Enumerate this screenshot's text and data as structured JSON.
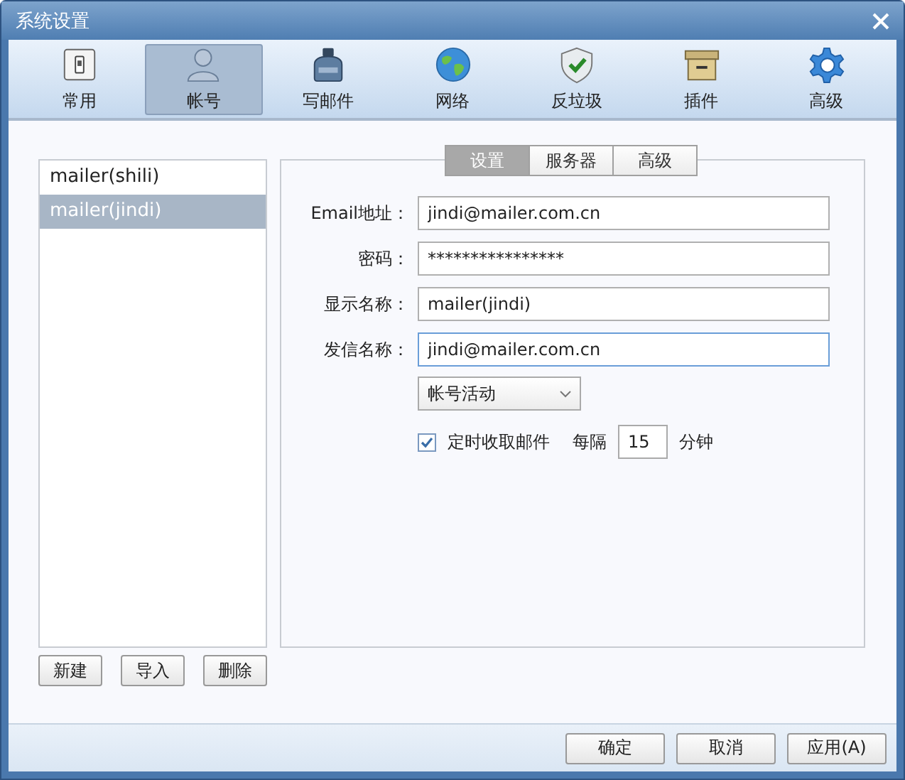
{
  "window": {
    "title": "系统设置"
  },
  "toolbar": [
    {
      "label": "常用",
      "kind": "general",
      "selected": false
    },
    {
      "label": "帐号",
      "kind": "account",
      "selected": true
    },
    {
      "label": "写邮件",
      "kind": "compose",
      "selected": false
    },
    {
      "label": "网络",
      "kind": "network",
      "selected": false
    },
    {
      "label": "反垃圾",
      "kind": "antispam",
      "selected": false
    },
    {
      "label": "插件",
      "kind": "plugin",
      "selected": false
    },
    {
      "label": "高级",
      "kind": "advanced",
      "selected": false
    }
  ],
  "accounts": [
    {
      "name": "mailer(shili)",
      "selected": false
    },
    {
      "name": "mailer(jindi)",
      "selected": true
    }
  ],
  "account_buttons": [
    "新建",
    "导入",
    "删除"
  ],
  "tabs": [
    {
      "label": "设置",
      "selected": true
    },
    {
      "label": "服务器",
      "selected": false
    },
    {
      "label": "高级",
      "selected": false
    }
  ],
  "fields": [
    {
      "label": "Email地址：",
      "value": "jindi@mailer.com.cn",
      "focused": false
    },
    {
      "label": "密码：",
      "value": "****************",
      "focused": false
    },
    {
      "label": "显示名称：",
      "value": "mailer(jindi)",
      "focused": false
    },
    {
      "label": "发信名称：",
      "value": "jindi@mailer.com.cn",
      "focused": true
    }
  ],
  "dropdown": {
    "value": "帐号活动"
  },
  "auto_fetch": {
    "label": "定时收取邮件",
    "checked": true,
    "every": "每隔",
    "interval": "15",
    "unit": "分钟"
  },
  "buttons": [
    "确定",
    "取消",
    "应用(A)"
  ]
}
